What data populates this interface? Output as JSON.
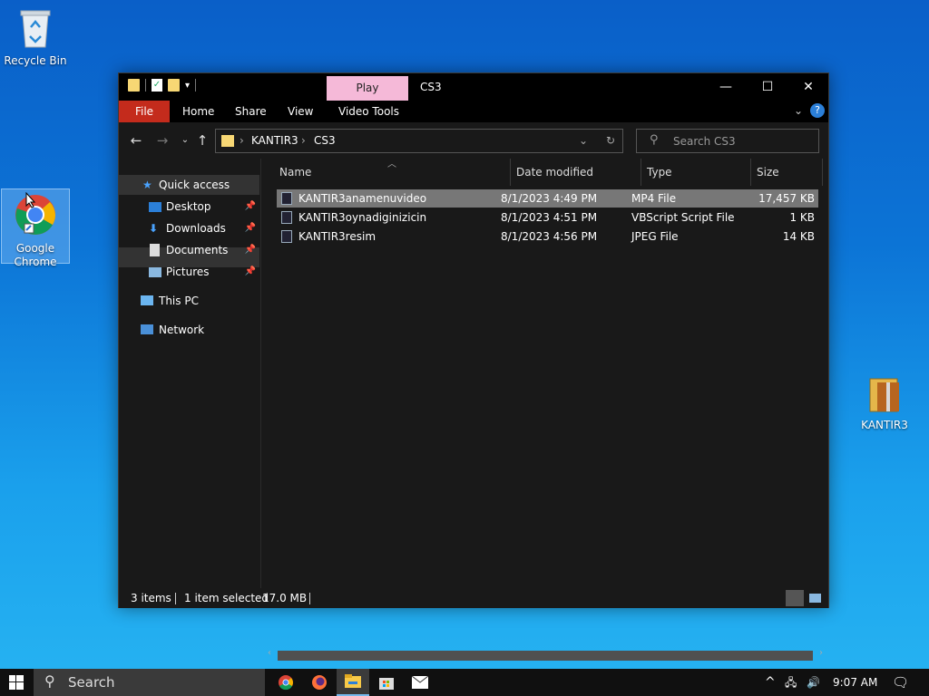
{
  "desktop": {
    "icons": [
      {
        "label": "Recycle Bin",
        "icon": "recycle-bin-icon"
      },
      {
        "label": "Google Chrome",
        "icon": "chrome-icon"
      },
      {
        "label": "KANTIR3",
        "icon": "folder-archive-icon"
      }
    ]
  },
  "window": {
    "title": "CS3",
    "context_tab": "Play",
    "ribbon_tabs": [
      "File",
      "Home",
      "Share",
      "View",
      "Video Tools"
    ],
    "controls": {
      "minimize": "—",
      "maximize": "☐",
      "close": "✕"
    },
    "address": {
      "crumbs": [
        "KANTIR3",
        "CS3"
      ]
    },
    "search": {
      "placeholder": "Search CS3"
    },
    "nav": {
      "quick_access": "Quick access",
      "items": [
        "Desktop",
        "Downloads",
        "Documents",
        "Pictures"
      ],
      "this_pc": "This PC",
      "network": "Network"
    },
    "columns": [
      "Name",
      "Date modified",
      "Type",
      "Size"
    ],
    "files": [
      {
        "name": "KANTIR3anamenuvideo",
        "date": "8/1/2023 4:49 PM",
        "type": "MP4 File",
        "size": "17,457 KB",
        "selected": true
      },
      {
        "name": "KANTIR3oynadiginizicin",
        "date": "8/1/2023 4:51 PM",
        "type": "VBScript Script File",
        "size": "1 KB",
        "selected": false
      },
      {
        "name": "KANTIR3resim",
        "date": "8/1/2023 4:56 PM",
        "type": "JPEG File",
        "size": "14 KB",
        "selected": false
      }
    ],
    "status": {
      "items": "3 items",
      "selected": "1 item selected",
      "size": "17.0 MB"
    }
  },
  "taskbar": {
    "search_placeholder": "Search",
    "time": "9:07 AM",
    "apps": [
      "chrome-icon",
      "firefox-icon",
      "file-explorer-icon",
      "store-icon",
      "mail-icon"
    ]
  },
  "colors": {
    "file_tab": "#c42b1c",
    "play_tab": "#f5b9d8",
    "selection": "#777777"
  }
}
